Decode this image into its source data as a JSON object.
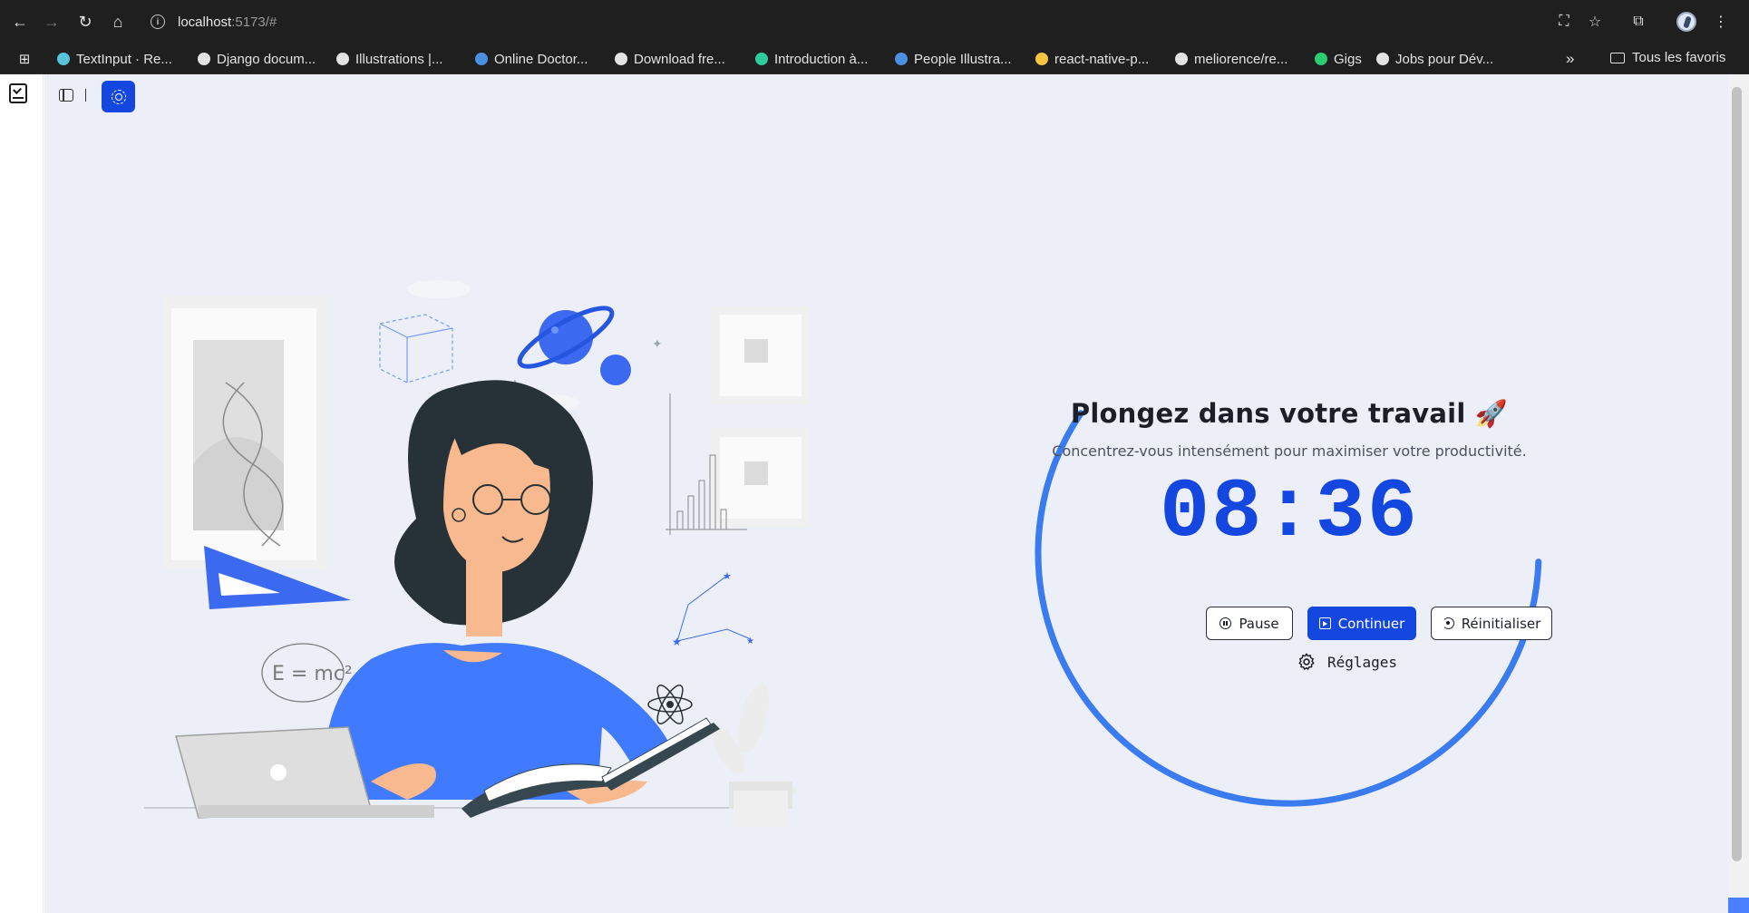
{
  "browser": {
    "url_host": "localhost",
    "url_rest": ":5173/#",
    "bookmarks": [
      {
        "label": "TextInput · Re...",
        "color": "#58c4dc"
      },
      {
        "label": "Django docum...",
        "color": "#e3e3e3"
      },
      {
        "label": "Illustrations |...",
        "color": "#e3e3e3"
      },
      {
        "label": "Online Doctor...",
        "color": "#4a90e2"
      },
      {
        "label": "Download fre...",
        "color": "#e3e3e3"
      },
      {
        "label": "Introduction à...",
        "color": "#2ecc9a"
      },
      {
        "label": "People Illustra...",
        "color": "#4a90e2"
      },
      {
        "label": "react-native-p...",
        "color": "#f5c542"
      },
      {
        "label": "meliorence/re...",
        "color": "#e3e3e3"
      },
      {
        "label": "Gigs",
        "color": "#2ecc71"
      },
      {
        "label": "Jobs pour Dév...",
        "color": "#e3e3e3"
      }
    ],
    "bookmark_more": "»",
    "all_bookmarks": "Tous les favoris"
  },
  "timer": {
    "title": "Plongez dans votre travail 🚀",
    "subtitle": "Concentrez-vous intensément pour maximiser votre productivité.",
    "time": "08:36",
    "progress": 0.53,
    "buttons": {
      "pause": "Pause",
      "continue": "Continuer",
      "reset": "Réinitialiser"
    },
    "settings": "Réglages"
  },
  "illustration": {
    "equation": "E = mc²"
  },
  "colors": {
    "accent": "#1447e0",
    "ring": "#3b7bf0",
    "background": "#edeff8"
  }
}
